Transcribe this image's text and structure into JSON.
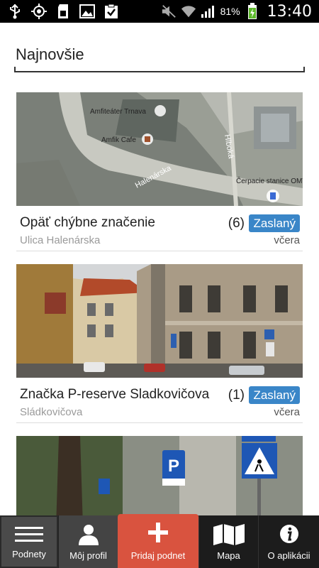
{
  "status_bar": {
    "battery_text": "81%",
    "time": "13:40",
    "icons": [
      "usb-icon",
      "gps-icon",
      "sd-card-icon",
      "image-icon",
      "clipboard-icon",
      "mute-icon",
      "wifi-icon",
      "signal-icon",
      "battery-icon"
    ]
  },
  "header": {
    "title": "Najnovšie"
  },
  "feed": {
    "items": [
      {
        "title": "Opäť chýbne značenie",
        "count": "(6)",
        "status": "Zaslaný",
        "place": "Ulica Halenárska",
        "time": "včera",
        "image": "map-photo"
      },
      {
        "title": "Značka P-reserve Sladkovičova",
        "count": "(1)",
        "status": "Zaslaný",
        "place": "Sládkovičova",
        "time": "včera",
        "image": "street-photo"
      },
      {
        "image": "signs-photo"
      }
    ],
    "map_labels": [
      "Amfiteáter Trnava",
      "Amfik Cafe",
      "Halenárska",
      "Hlboká",
      "Čerpacie stanice OMV"
    ]
  },
  "tabbar": {
    "tabs": [
      {
        "label": "Podnety",
        "icon": "list-icon",
        "active": true
      },
      {
        "label": "Môj profil",
        "icon": "person-icon"
      },
      {
        "label": "Pridaj podnet",
        "icon": "plus-icon"
      },
      {
        "label": "Mapa",
        "icon": "map-icon"
      },
      {
        "label": "O aplikácii",
        "icon": "info-icon"
      }
    ]
  },
  "colors": {
    "accent": "#d9533f",
    "badge": "#3a86c8",
    "tabbar": "#1c1c1c"
  }
}
